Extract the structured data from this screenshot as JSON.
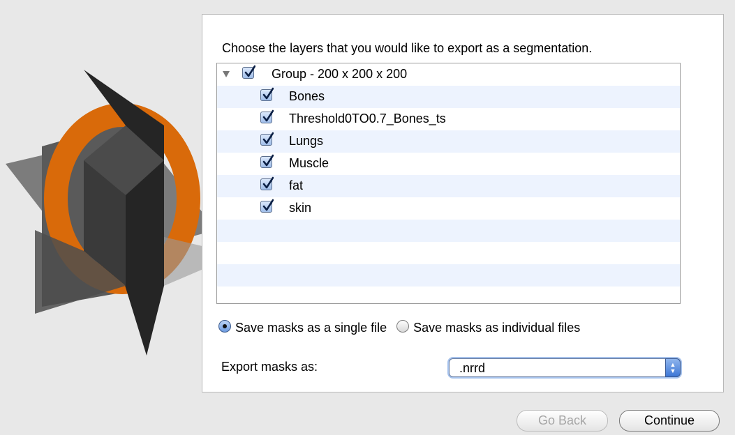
{
  "dialog": {
    "prompt": "Choose the layers that you would like to export as a segmentation."
  },
  "layers": [
    {
      "label": "Group - 200 x 200 x 200",
      "checked": true,
      "is_group": true
    },
    {
      "label": "Bones",
      "checked": true
    },
    {
      "label": "Threshold0TO0.7_Bones_ts",
      "checked": true
    },
    {
      "label": "Lungs",
      "checked": true
    },
    {
      "label": "Muscle",
      "checked": true
    },
    {
      "label": "fat",
      "checked": true
    },
    {
      "label": "skin",
      "checked": true
    }
  ],
  "options": {
    "single_file_label": "Save masks as a single file",
    "individual_files_label": "Save masks as individual files",
    "selected": "single_file"
  },
  "export": {
    "label": "Export masks as:",
    "format": ".nrrd"
  },
  "buttons": {
    "go_back": "Go Back",
    "continue": "Continue"
  },
  "colors": {
    "accent": "#e8720c",
    "selection": "#3d77d6",
    "row_alt": "#edf3fe"
  },
  "icons": {
    "logo": "3d-slicer-logo-icon",
    "checkbox": "checkmark-icon",
    "disclosure": "disclosure-triangle-icon",
    "select": "up-down-arrows-icon"
  }
}
